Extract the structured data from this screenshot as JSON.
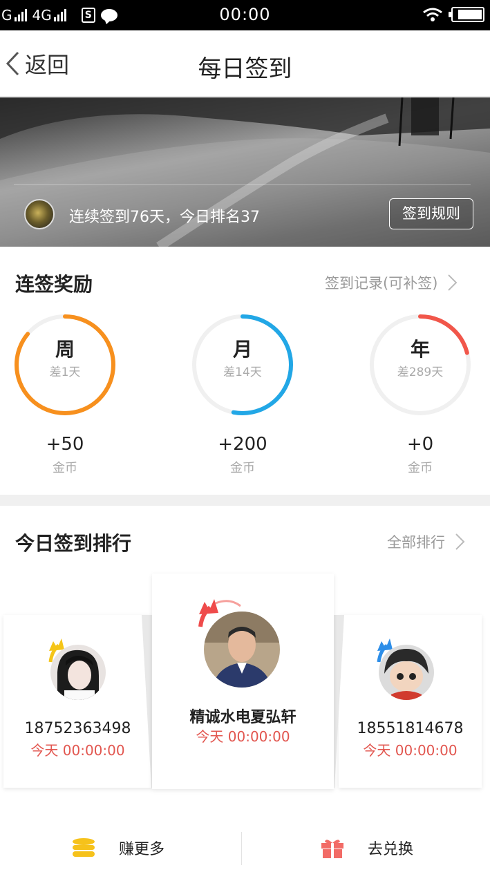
{
  "status_bar": {
    "network_a": "G",
    "network_b": "4G",
    "sim_label": "S",
    "time": "00:00"
  },
  "nav": {
    "back_label": "返回",
    "title": "每日签到"
  },
  "banner": {
    "status_text": "连续签到76天，今日排名37",
    "rules_button": "签到规则"
  },
  "rewards": {
    "title": "连签奖励",
    "history_link": "签到记录(可补签)",
    "items": [
      {
        "title": "周",
        "remaining": "差1天",
        "reward": "+50",
        "unit": "金币",
        "progress": 0.86,
        "color": "#f7901e"
      },
      {
        "title": "月",
        "remaining": "差14天",
        "reward": "+200",
        "unit": "金币",
        "progress": 0.53,
        "color": "#22a7e6"
      },
      {
        "title": "年",
        "remaining": "差289天",
        "reward": "+0",
        "unit": "金币",
        "progress": 0.21,
        "color": "#f1564a"
      }
    ]
  },
  "ranking": {
    "title": "今日签到排行",
    "all_link": "全部排行",
    "entries": [
      {
        "rank": 1,
        "name": "精诚水电夏弘轩",
        "time": "今天 00:00:00",
        "crown_color": "#ef4b4b"
      },
      {
        "rank": 2,
        "name": "18752363498",
        "time": "今天 00:00:00",
        "crown_color": "#f5c518"
      },
      {
        "rank": 3,
        "name": "18551814678",
        "time": "今天 00:00:00",
        "crown_color": "#2d8ee8"
      }
    ]
  },
  "bottom_bar": {
    "earn_label": "赚更多",
    "redeem_label": "去兑换"
  },
  "colors": {
    "accent_red": "#e2564f",
    "coin_yellow": "#f6c21b",
    "gift_red": "#f26b66"
  }
}
